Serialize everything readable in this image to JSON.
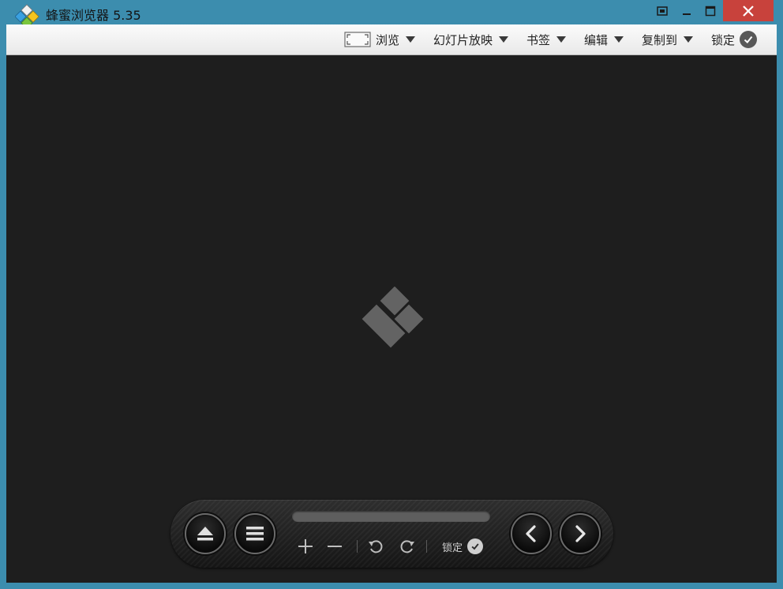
{
  "window": {
    "title": "蜂蜜浏览器 5.35",
    "controls": [
      "restore-alt",
      "minimize",
      "maximize",
      "close"
    ]
  },
  "menu": {
    "browse": "浏览",
    "slideshow": "幻灯片放映",
    "bookmarks": "书签",
    "edit": "编辑",
    "copy_to": "复制到",
    "lock": "锁定"
  },
  "controlbar": {
    "lock_label": "锁定",
    "buttons": [
      "eject",
      "list",
      "zoom-in",
      "zoom-out",
      "rotate-left",
      "rotate-right",
      "previous",
      "next"
    ]
  },
  "colors": {
    "titlebar": "#3c8dae",
    "close_button": "#c8423c",
    "viewer_background": "#1e1e1e"
  }
}
